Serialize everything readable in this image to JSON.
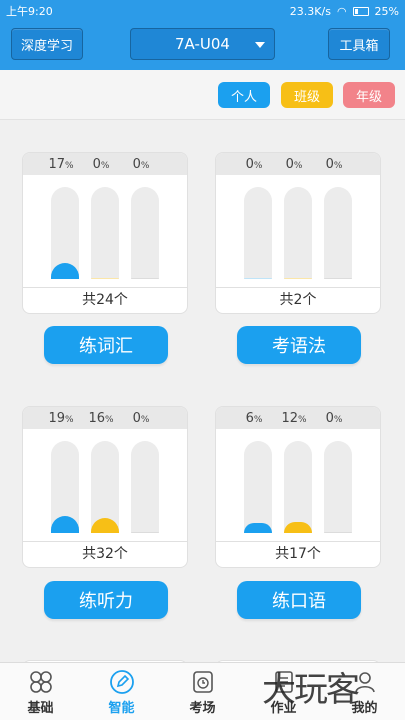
{
  "status": {
    "time": "上午9:20",
    "speed": "23.3K/s",
    "battery": "25%"
  },
  "header": {
    "left_btn": "深度学习",
    "unit": "7A-U04",
    "right_btn": "工具箱"
  },
  "filters": {
    "self": "个人",
    "class": "班级",
    "grade": "年级"
  },
  "colors": {
    "blue": "#1ba0ef",
    "yellow": "#f7bf16",
    "pink": "#f2838a"
  },
  "cards": [
    {
      "pcts": [
        "17",
        "0",
        "0"
      ],
      "levels": [
        17,
        0,
        0
      ],
      "total": "共24个",
      "action": "练词汇"
    },
    {
      "pcts": [
        "0",
        "0",
        "0"
      ],
      "levels": [
        0,
        0,
        0
      ],
      "total": "共2个",
      "action": "考语法"
    },
    {
      "pcts": [
        "19",
        "16",
        "0"
      ],
      "levels": [
        19,
        16,
        0
      ],
      "total": "共32个",
      "action": "练听力"
    },
    {
      "pcts": [
        "6",
        "12",
        "0"
      ],
      "levels": [
        6,
        12,
        0
      ],
      "total": "共17个",
      "action": "练口语"
    }
  ],
  "pct_unit": "%",
  "tabs": [
    {
      "label": "基础",
      "icon": "grid-icon"
    },
    {
      "label": "智能",
      "icon": "pencil-icon"
    },
    {
      "label": "考场",
      "icon": "clock-icon"
    },
    {
      "label": "作业",
      "icon": "homework-icon"
    },
    {
      "label": "我的",
      "icon": "person-icon"
    }
  ],
  "watermark": "大玩客"
}
